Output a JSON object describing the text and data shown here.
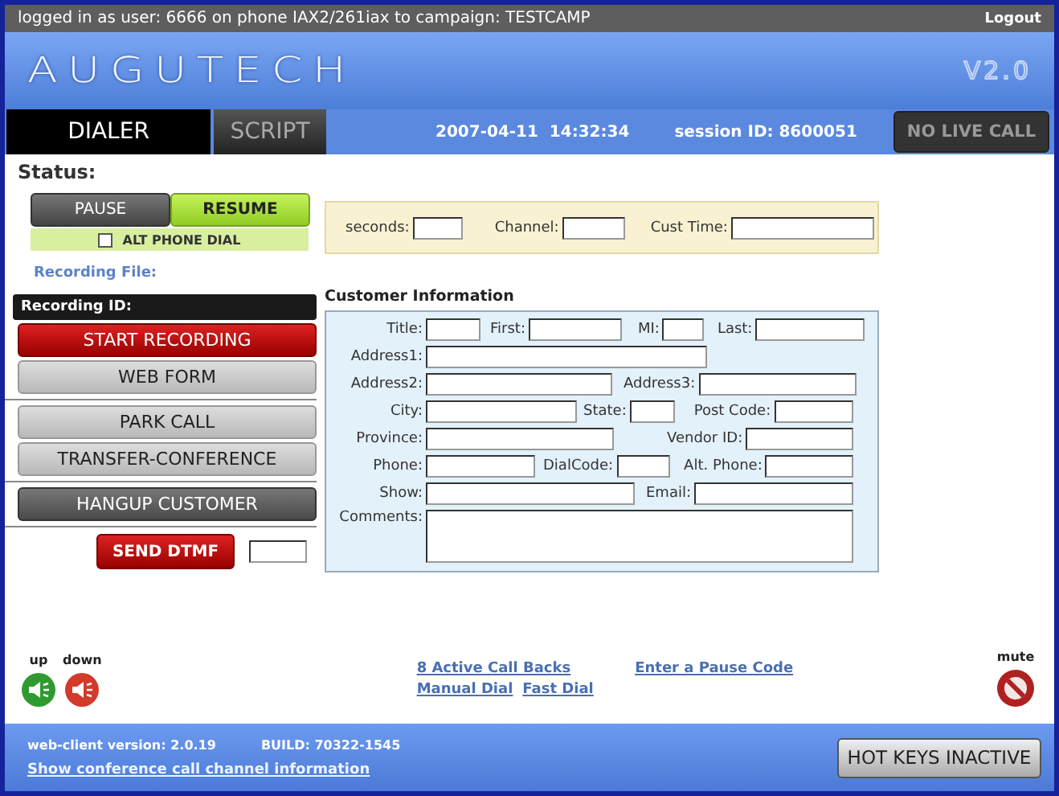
{
  "top_bar": {
    "user_info": "logged in as user: 6666 on phone IAX2/261iax to campaign: TESTCAMP",
    "logout": "Logout"
  },
  "header": {
    "logo": "AUGUTECH",
    "version": "V2.0"
  },
  "tabs": [
    {
      "label": "DIALER",
      "selected": true
    },
    {
      "label": "SCRIPT",
      "selected": false
    }
  ],
  "datetime": "2007-04-11  14:32:34",
  "session": "session ID: 8600051",
  "call_status": "NO LIVE CALL",
  "status_label": "Status:",
  "pause_buttons": [
    {
      "label": "PAUSE",
      "selected": false
    },
    {
      "label": "RESUME",
      "selected": true
    }
  ],
  "alt_phone_dial": {
    "label": "ALT PHONE DIAL",
    "checked": false
  },
  "recording_file_label": "Recording File:",
  "recording_id_label": "Recording ID:",
  "action_groups": [
    [
      {
        "label": "START RECORDING",
        "kind": "danger"
      },
      {
        "label": "WEB FORM",
        "kind": "normal"
      }
    ],
    [
      {
        "label": "PARK CALL",
        "kind": "normal"
      },
      {
        "label": "TRANSFER-CONFERENCE",
        "kind": "normal"
      }
    ],
    [
      {
        "label": "HANGUP CUSTOMER",
        "kind": "dark"
      }
    ]
  ],
  "dtmf_button": "SEND DTMF",
  "call_fields": [
    {
      "label": "seconds:"
    },
    {
      "label": "Channel:"
    },
    {
      "label": "Cust Time:"
    }
  ],
  "customer_info": {
    "title": "Customer Information",
    "rows": [
      [
        {
          "label": "Title:"
        },
        {
          "label": "First:"
        },
        {
          "label": "MI:"
        },
        {
          "label": "Last:"
        }
      ],
      [
        {
          "label": "Address1:"
        }
      ],
      [
        {
          "label": "Address2:"
        },
        {
          "label": "Address3:"
        }
      ],
      [
        {
          "label": "City:"
        },
        {
          "label": "State:"
        },
        {
          "label": "Post Code:"
        }
      ],
      [
        {
          "label": "Province:"
        },
        {
          "label": "Vendor ID:"
        }
      ],
      [
        {
          "label": "Phone:"
        },
        {
          "label": "DialCode:"
        },
        {
          "label": "Alt. Phone:"
        }
      ],
      [
        {
          "label": "Show:"
        },
        {
          "label": "Email:"
        }
      ]
    ],
    "comments_label": "Comments:"
  },
  "volume": [
    {
      "label": "up",
      "kind": "up"
    },
    {
      "label": "down",
      "kind": "down"
    }
  ],
  "mute_label": "mute",
  "links": {
    "callbacks": "8 Active Call Backs",
    "manual_dial": "Manual Dial",
    "fast_dial": "Fast Dial",
    "pause_code": "Enter a Pause Code"
  },
  "footer": {
    "version": "web-client version: 2.0.19",
    "build": "BUILD: 70322-1545",
    "conference_link": "Show conference call channel information",
    "hot_keys": "HOT KEYS INACTIVE"
  }
}
